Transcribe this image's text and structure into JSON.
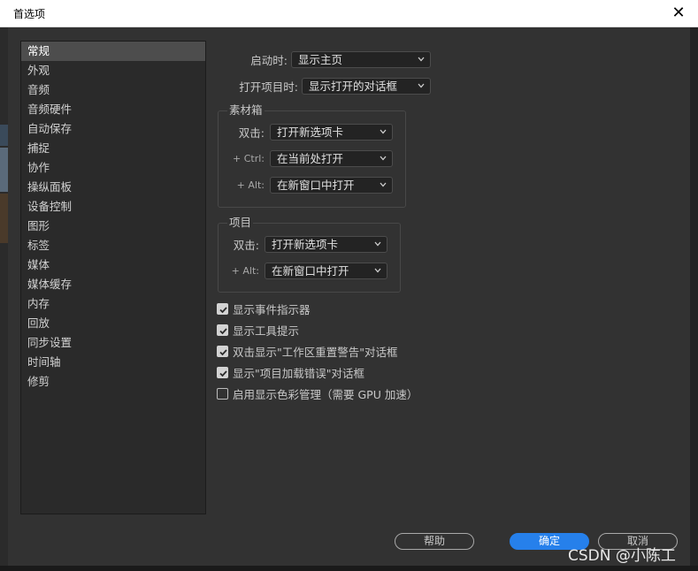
{
  "window": {
    "title": "首选项",
    "close_glyph": "✕"
  },
  "sidebar": {
    "items": [
      {
        "label": "常规",
        "selected": true
      },
      {
        "label": "外观"
      },
      {
        "label": "音频"
      },
      {
        "label": "音频硬件"
      },
      {
        "label": "自动保存"
      },
      {
        "label": "捕捉"
      },
      {
        "label": "协作"
      },
      {
        "label": "操纵面板"
      },
      {
        "label": "设备控制"
      },
      {
        "label": "图形"
      },
      {
        "label": "标签"
      },
      {
        "label": "媒体"
      },
      {
        "label": "媒体缓存"
      },
      {
        "label": "内存"
      },
      {
        "label": "回放"
      },
      {
        "label": "同步设置"
      },
      {
        "label": "时间轴"
      },
      {
        "label": "修剪"
      }
    ]
  },
  "general": {
    "startup": {
      "label": "启动时:",
      "value": "显示主页"
    },
    "open_project": {
      "label": "打开项目时:",
      "value": "显示打开的对话框"
    },
    "bin": {
      "title": "素材箱",
      "double_click": {
        "label": "双击:",
        "value": "打开新选项卡"
      },
      "ctrl": {
        "label": "+ Ctrl:",
        "value": "在当前处打开"
      },
      "alt": {
        "label": "+ Alt:",
        "value": "在新窗口中打开"
      }
    },
    "project": {
      "title": "项目",
      "double_click": {
        "label": "双击:",
        "value": "打开新选项卡"
      },
      "alt": {
        "label": "+ Alt:",
        "value": "在新窗口中打开"
      }
    },
    "checkboxes": [
      {
        "label": "显示事件指示器",
        "checked": true
      },
      {
        "label": "显示工具提示",
        "checked": true
      },
      {
        "label": "双击显示\"工作区重置警告\"对话框",
        "checked": true
      },
      {
        "label": "显示\"项目加载错误\"对话框",
        "checked": true
      },
      {
        "label": "启用显示色彩管理（需要 GPU 加速）",
        "checked": false
      }
    ]
  },
  "buttons": {
    "help": "帮助",
    "ok": "确定",
    "cancel": "取消"
  },
  "watermark": "CSDN @小陈工",
  "colors": {
    "accent": "#2680eb",
    "panel": "#323232",
    "sidebar_selected": "#4d4d4d"
  },
  "icons": {
    "close": "close-icon",
    "dropdown": "chevron-down-icon",
    "check": "check-icon"
  }
}
